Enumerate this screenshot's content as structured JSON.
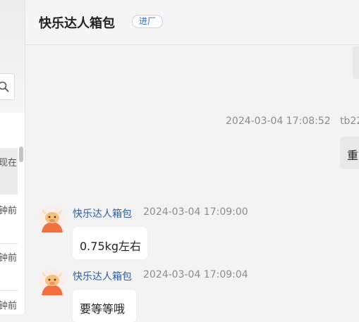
{
  "sidebar": {
    "items": [
      {
        "label": "现在"
      },
      {
        "label": "钟前"
      },
      {
        "label": "钟前"
      },
      {
        "label": "钟前"
      }
    ]
  },
  "header": {
    "title": "快乐达人箱包",
    "tag": "进厂"
  },
  "chat": {
    "outgoing": {
      "timestamp": "2024-03-04 17:08:52",
      "sender": "tb22",
      "text": "重"
    },
    "messages": [
      {
        "sender": "快乐达人箱包",
        "time": "2024-03-04 17:09:00",
        "text": "0.75kg左右"
      },
      {
        "sender": "快乐达人箱包",
        "time": "2024-03-04 17:09:04",
        "text": "要等等哦"
      }
    ]
  },
  "colors": {
    "accent": "#2d6bd6",
    "sender": "#2e5ea8",
    "muted": "#8c8c8c"
  },
  "icons": [
    "search-icon",
    "ox-avatar-icon"
  ]
}
